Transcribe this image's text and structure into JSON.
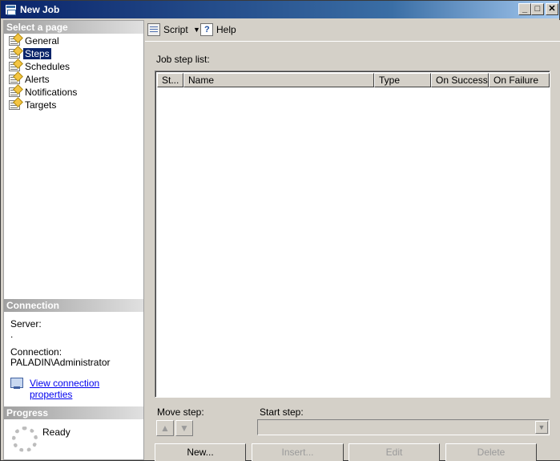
{
  "window": {
    "title": "New Job"
  },
  "left": {
    "select_page_header": "Select a page",
    "pages": [
      {
        "label": "General",
        "selected": false
      },
      {
        "label": "Steps",
        "selected": true
      },
      {
        "label": "Schedules",
        "selected": false
      },
      {
        "label": "Alerts",
        "selected": false
      },
      {
        "label": "Notifications",
        "selected": false
      },
      {
        "label": "Targets",
        "selected": false
      }
    ],
    "connection": {
      "header": "Connection",
      "server_label": "Server:",
      "server_value": ".",
      "connection_label": "Connection:",
      "connection_value": "PALADIN\\Administrator",
      "view_properties_link": "View connection properties"
    },
    "progress": {
      "header": "Progress",
      "status": "Ready"
    }
  },
  "toolbar": {
    "script_label": "Script",
    "help_label": "Help"
  },
  "main": {
    "job_step_list_label": "Job step list:",
    "columns": [
      "St...",
      "Name",
      "Type",
      "On Success",
      "On Failure"
    ],
    "rows": [],
    "move_step_label": "Move step:",
    "start_step_label": "Start step:",
    "start_step_value": "",
    "buttons": {
      "new": "New...",
      "insert": "Insert...",
      "edit": "Edit",
      "delete": "Delete"
    }
  }
}
